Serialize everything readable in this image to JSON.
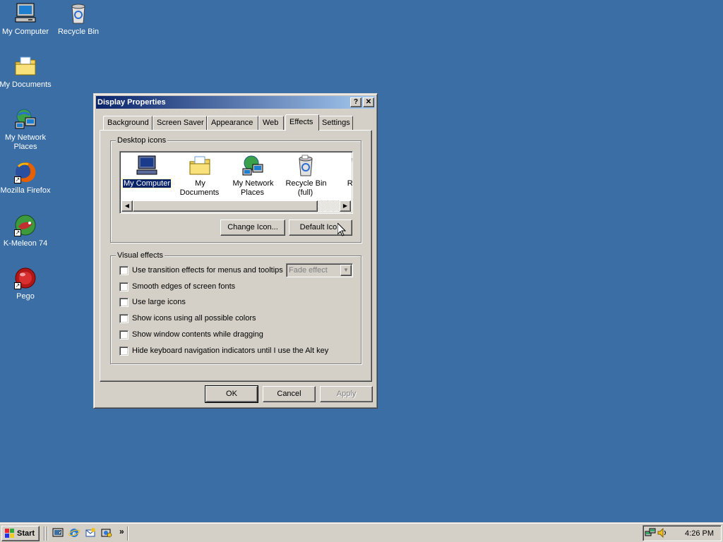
{
  "desktop": {
    "background_color": "#3a6ea5",
    "icons": [
      {
        "label": "My Computer",
        "icon": "my-computer-icon"
      },
      {
        "label": "Recycle Bin",
        "icon": "recycle-bin-icon"
      },
      {
        "label": "My Documents",
        "icon": "my-documents-icon"
      },
      {
        "label": "My Network Places",
        "icon": "network-places-icon"
      },
      {
        "label": "Mozilla Firefox",
        "icon": "firefox-icon"
      },
      {
        "label": "K-Meleon 74",
        "icon": "k-meleon-icon"
      },
      {
        "label": "Pego",
        "icon": "pego-icon"
      }
    ]
  },
  "dialog": {
    "title": "Display Properties",
    "help_glyph": "?",
    "close_glyph": "✕",
    "tabs": [
      "Background",
      "Screen Saver",
      "Appearance",
      "Web",
      "Effects",
      "Settings"
    ],
    "active_tab": "Effects",
    "desktop_icons_group": {
      "legend": "Desktop icons",
      "items": [
        {
          "label": "My Computer",
          "selected": true
        },
        {
          "label": "My Documents"
        },
        {
          "label": "My Network Places"
        },
        {
          "label": "Recycle Bin (full)"
        },
        {
          "label": "Rec (e"
        }
      ],
      "change_icon_button": "Change Icon...",
      "default_icon_button": "Default Icon"
    },
    "visual_effects_group": {
      "legend": "Visual effects",
      "transition_dropdown": "Fade effect",
      "options": [
        {
          "label": "Use transition effects for menus and tooltips",
          "checked": false
        },
        {
          "label": "Smooth edges of screen fonts",
          "checked": false
        },
        {
          "label": "Use large icons",
          "checked": false
        },
        {
          "label": "Show icons using all possible colors",
          "checked": false
        },
        {
          "label": "Show window contents while dragging",
          "checked": false
        },
        {
          "label": "Hide keyboard navigation indicators until I use the Alt key",
          "checked": false
        }
      ]
    },
    "buttons": {
      "ok": "OK",
      "cancel": "Cancel",
      "apply": "Apply"
    }
  },
  "taskbar": {
    "start_label": "Start",
    "quick_launch_more": "»",
    "clock": "4:26 PM"
  }
}
